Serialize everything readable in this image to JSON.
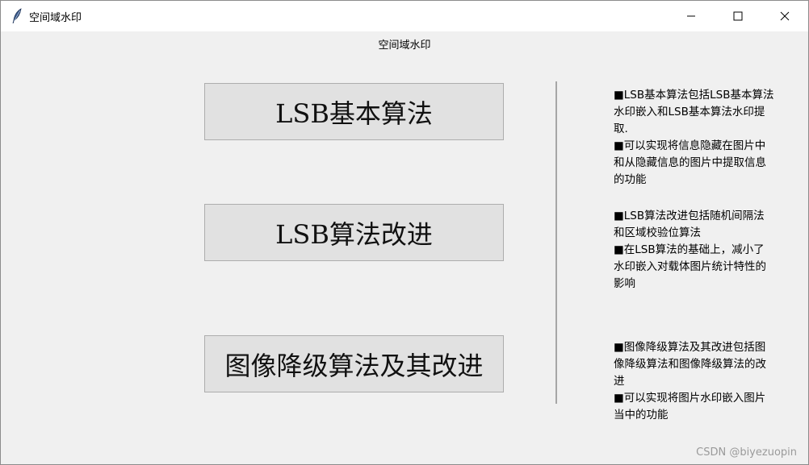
{
  "window": {
    "title": "空间域水印",
    "icon": "feather-icon",
    "controls": {
      "minimize": "minimize-icon",
      "maximize": "maximize-icon",
      "close": "close-icon"
    }
  },
  "header": {
    "label": "空间域水印"
  },
  "buttons": [
    {
      "label": "LSB基本算法"
    },
    {
      "label": "LSB算法改进"
    },
    {
      "label": "图像降级算法及其改进"
    }
  ],
  "descriptions": [
    {
      "lines": [
        "■LSB基本算法包括LSB基本算法水印嵌入和LSB基本算法水印提取.",
        "■可以实现将信息隐藏在图片中和从隐藏信息的图片中提取信息的功能"
      ]
    },
    {
      "lines": [
        "■LSB算法改进包括随机间隔法和区域校验位算法",
        "■在LSB算法的基础上，减小了水印嵌入对载体图片统计特性的影响"
      ]
    },
    {
      "lines": [
        "■图像降级算法及其改进包括图像降级算法和图像降级算法的改进",
        "■可以实现将图片水印嵌入图片当中的功能"
      ]
    }
  ],
  "watermark": "CSDN @biyezuopin",
  "colors": {
    "background": "#f0f0f0",
    "button_face": "#e1e1e1",
    "button_border": "#adadad",
    "divider": "#a6a6a6"
  }
}
